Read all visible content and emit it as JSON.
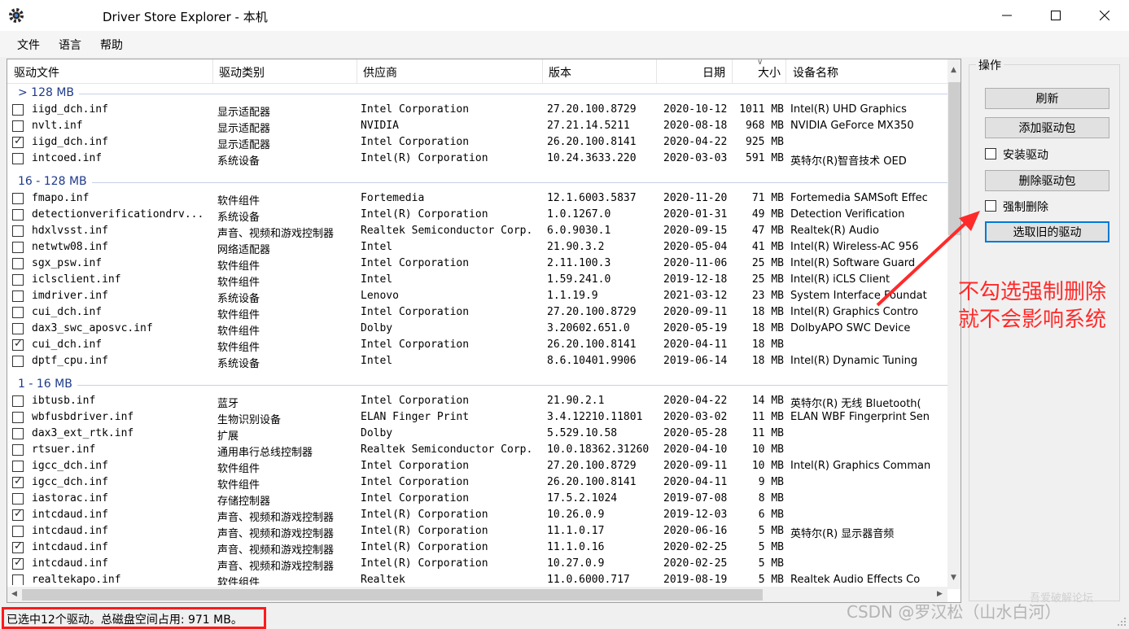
{
  "window": {
    "title": "Driver Store Explorer - 本机"
  },
  "menu": [
    "文件",
    "语言",
    "帮助"
  ],
  "columns": [
    "驱动文件",
    "驱动类别",
    "供应商",
    "版本",
    "日期",
    "大小",
    "设备名称"
  ],
  "groups": [
    {
      "label": "> 128 MB",
      "rows": [
        {
          "checked": false,
          "file": "iigd_dch.inf",
          "category": "显示适配器",
          "vendor": "Intel Corporation",
          "version": "27.20.100.8729",
          "date": "2020-10-12",
          "size": "1011 MB",
          "device": "Intel(R) UHD Graphics"
        },
        {
          "checked": false,
          "file": "nvlt.inf",
          "category": "显示适配器",
          "vendor": "NVIDIA",
          "version": "27.21.14.5211",
          "date": "2020-08-18",
          "size": "968 MB",
          "device": "NVIDIA GeForce MX350"
        },
        {
          "checked": true,
          "file": "iigd_dch.inf",
          "category": "显示适配器",
          "vendor": "Intel Corporation",
          "version": "26.20.100.8141",
          "date": "2020-04-22",
          "size": "925 MB",
          "device": ""
        },
        {
          "checked": false,
          "file": "intcoed.inf",
          "category": "系统设备",
          "vendor": "Intel(R) Corporation",
          "version": "10.24.3633.220",
          "date": "2020-03-03",
          "size": "591 MB",
          "device": "英特尔(R)智音技术 OED"
        }
      ]
    },
    {
      "label": "16 - 128 MB",
      "rows": [
        {
          "checked": false,
          "file": "fmapo.inf",
          "category": "软件组件",
          "vendor": "Fortemedia",
          "version": "12.1.6003.5837",
          "date": "2020-11-20",
          "size": "71 MB",
          "device": "Fortemedia SAMSoft Effec"
        },
        {
          "checked": false,
          "file": "detectionverificationdrv...",
          "category": "系统设备",
          "vendor": "Intel(R) Corporation",
          "version": "1.0.1267.0",
          "date": "2020-01-31",
          "size": "49 MB",
          "device": "Detection Verification"
        },
        {
          "checked": false,
          "file": "hdxlvsst.inf",
          "category": "声音、视频和游戏控制器",
          "vendor": "Realtek Semiconductor Corp.",
          "version": "6.0.9030.1",
          "date": "2020-09-15",
          "size": "47 MB",
          "device": "Realtek(R) Audio"
        },
        {
          "checked": false,
          "file": "netwtw08.inf",
          "category": "网络适配器",
          "vendor": "Intel",
          "version": "21.90.3.2",
          "date": "2020-05-04",
          "size": "41 MB",
          "device": "Intel(R) Wireless-AC 956"
        },
        {
          "checked": false,
          "file": "sgx_psw.inf",
          "category": "软件组件",
          "vendor": "Intel Corporation",
          "version": "2.11.100.3",
          "date": "2020-11-06",
          "size": "25 MB",
          "device": "Intel(R) Software Guard"
        },
        {
          "checked": false,
          "file": "iclsclient.inf",
          "category": "软件组件",
          "vendor": "Intel",
          "version": "1.59.241.0",
          "date": "2019-12-18",
          "size": "25 MB",
          "device": "Intel(R) iCLS Client"
        },
        {
          "checked": false,
          "file": "imdriver.inf",
          "category": "系统设备",
          "vendor": "Lenovo",
          "version": "1.1.19.9",
          "date": "2021-03-12",
          "size": "23 MB",
          "device": "System Interface Foundat"
        },
        {
          "checked": false,
          "file": "cui_dch.inf",
          "category": "软件组件",
          "vendor": "Intel Corporation",
          "version": "27.20.100.8729",
          "date": "2020-09-11",
          "size": "18 MB",
          "device": "Intel(R) Graphics Contro"
        },
        {
          "checked": false,
          "file": "dax3_swc_aposvc.inf",
          "category": "软件组件",
          "vendor": "Dolby",
          "version": "3.20602.651.0",
          "date": "2020-05-19",
          "size": "18 MB",
          "device": "DolbyAPO SWC Device"
        },
        {
          "checked": true,
          "file": "cui_dch.inf",
          "category": "软件组件",
          "vendor": "Intel Corporation",
          "version": "26.20.100.8141",
          "date": "2020-04-11",
          "size": "18 MB",
          "device": ""
        },
        {
          "checked": false,
          "file": "dptf_cpu.inf",
          "category": "系统设备",
          "vendor": "Intel",
          "version": "8.6.10401.9906",
          "date": "2019-06-14",
          "size": "18 MB",
          "device": "Intel(R) Dynamic Tuning"
        }
      ]
    },
    {
      "label": "1 - 16 MB",
      "rows": [
        {
          "checked": false,
          "file": "ibtusb.inf",
          "category": "蓝牙",
          "vendor": "Intel Corporation",
          "version": "21.90.2.1",
          "date": "2020-04-22",
          "size": "14 MB",
          "device": "英特尔(R) 无线 Bluetooth("
        },
        {
          "checked": false,
          "file": "wbfusbdriver.inf",
          "category": "生物识别设备",
          "vendor": "ELAN Finger Print",
          "version": "3.4.12210.11801",
          "date": "2020-03-02",
          "size": "11 MB",
          "device": "ELAN WBF Fingerprint Sen"
        },
        {
          "checked": false,
          "file": "dax3_ext_rtk.inf",
          "category": "扩展",
          "vendor": "Dolby",
          "version": "5.529.10.58",
          "date": "2020-05-28",
          "size": "11 MB",
          "device": ""
        },
        {
          "checked": false,
          "file": "rtsuer.inf",
          "category": "通用串行总线控制器",
          "vendor": "Realtek Semiconductor Corp.",
          "version": "10.0.18362.31260",
          "date": "2020-04-10",
          "size": "10 MB",
          "device": ""
        },
        {
          "checked": false,
          "file": "igcc_dch.inf",
          "category": "软件组件",
          "vendor": "Intel Corporation",
          "version": "27.20.100.8729",
          "date": "2020-09-11",
          "size": "10 MB",
          "device": "Intel(R) Graphics Comman"
        },
        {
          "checked": true,
          "file": "igcc_dch.inf",
          "category": "软件组件",
          "vendor": "Intel Corporation",
          "version": "26.20.100.8141",
          "date": "2020-04-11",
          "size": "9 MB",
          "device": ""
        },
        {
          "checked": false,
          "file": "iastorac.inf",
          "category": "存储控制器",
          "vendor": "Intel Corporation",
          "version": "17.5.2.1024",
          "date": "2019-07-08",
          "size": "8 MB",
          "device": ""
        },
        {
          "checked": true,
          "file": "intcdaud.inf",
          "category": "声音、视频和游戏控制器",
          "vendor": "Intel(R) Corporation",
          "version": "10.26.0.9",
          "date": "2019-12-03",
          "size": "6 MB",
          "device": ""
        },
        {
          "checked": false,
          "file": "intcdaud.inf",
          "category": "声音、视频和游戏控制器",
          "vendor": "Intel(R) Corporation",
          "version": "11.1.0.17",
          "date": "2020-06-16",
          "size": "5 MB",
          "device": "英特尔(R) 显示器音频"
        },
        {
          "checked": true,
          "file": "intcdaud.inf",
          "category": "声音、视频和游戏控制器",
          "vendor": "Intel(R) Corporation",
          "version": "11.1.0.16",
          "date": "2020-02-25",
          "size": "5 MB",
          "device": ""
        },
        {
          "checked": true,
          "file": "intcdaud.inf",
          "category": "声音、视频和游戏控制器",
          "vendor": "Intel(R) Corporation",
          "version": "10.27.0.9",
          "date": "2020-02-25",
          "size": "5 MB",
          "device": ""
        },
        {
          "checked": false,
          "file": "realtekapo.inf",
          "category": "软件组件",
          "vendor": "Realtek",
          "version": "11.0.6000.717",
          "date": "2019-08-19",
          "size": "5 MB",
          "device": "Realtek Audio Effects Co"
        }
      ]
    }
  ],
  "panel": {
    "title": "操作",
    "refresh": "刷新",
    "add_package": "添加驱动包",
    "install_driver": "安装驱动",
    "delete_package": "删除驱动包",
    "force_delete": "强制删除",
    "select_old": "选取旧的驱动"
  },
  "annotation": {
    "line1": "不勾选强制删除",
    "line2": "就不会影响系统",
    "color": "#ff2a2a"
  },
  "status": "已选中12个驱动。总磁盘空间占用: 971 MB。",
  "watermark": "CSDN @罗汉松（山水白河）",
  "watermark2": "吾爱破解论坛"
}
